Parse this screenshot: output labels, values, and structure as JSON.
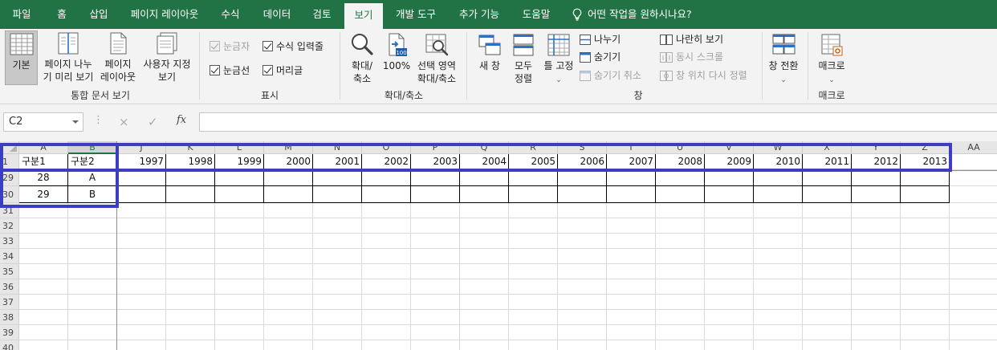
{
  "tabs": [
    "파일",
    "홈",
    "삽입",
    "페이지 레이아웃",
    "수식",
    "데이터",
    "검토",
    "보기",
    "개발 도구",
    "추가 기능",
    "도움말"
  ],
  "active_tab": "보기",
  "tell_me": "어떤 작업을 원하시나요?",
  "ribbon": {
    "workbook_views": {
      "label": "통합 문서 보기",
      "normal": "기본",
      "page_break_1": "페이지 나누",
      "page_break_2": "기 미리 보기",
      "page_layout_1": "페이지",
      "page_layout_2": "레이아웃",
      "custom_1": "사용자 지정",
      "custom_2": "보기"
    },
    "show": {
      "label": "표시",
      "ruler": "눈금자",
      "formula_bar": "수식 입력줄",
      "gridlines": "눈금선",
      "headings": "머리글"
    },
    "zoom": {
      "label": "확대/축소",
      "zoom_1": "확대/",
      "zoom_2": "축소",
      "hundred": "100%",
      "sel_1": "선택 영역",
      "sel_2": "확대/축소"
    },
    "window": {
      "label": "창",
      "new_window": "새 창",
      "arrange_1": "모두",
      "arrange_2": "정렬",
      "freeze": "틀 고정",
      "split": "나누기",
      "hide": "숨기기",
      "unhide": "숨기기 취소",
      "side_by_side": "나란히 보기",
      "sync_scroll": "동시 스크롤",
      "reset_pos": "창 위치 다시 정렬",
      "switch": "창 전환"
    },
    "macros": {
      "label": "매크로",
      "macros": "매크로"
    }
  },
  "formula_bar": {
    "name_box": "C2",
    "cancel_icon": "×",
    "enter_icon": "✓",
    "fx": "fx",
    "value": ""
  },
  "sheet": {
    "col_headers": [
      "A",
      "B",
      "J",
      "K",
      "L",
      "M",
      "N",
      "O",
      "P",
      "Q",
      "R",
      "S",
      "T",
      "U",
      "V",
      "W",
      "X",
      "Y",
      "Z",
      "AA"
    ],
    "row_headers": [
      "1",
      "29",
      "30",
      "31",
      "32",
      "33",
      "34",
      "35",
      "36",
      "37",
      "38",
      "39",
      "40"
    ],
    "row1": [
      "구분1",
      "구분2",
      "1997",
      "1998",
      "1999",
      "2000",
      "2001",
      "2002",
      "2003",
      "2004",
      "2005",
      "2006",
      "2007",
      "2008",
      "2009",
      "2010",
      "2011",
      "2012",
      "2013"
    ],
    "row29": [
      "28",
      "A"
    ],
    "row30": [
      "29",
      "B"
    ]
  },
  "colors": {
    "excel_green": "#217346",
    "highlight": "#3d3dc4"
  }
}
